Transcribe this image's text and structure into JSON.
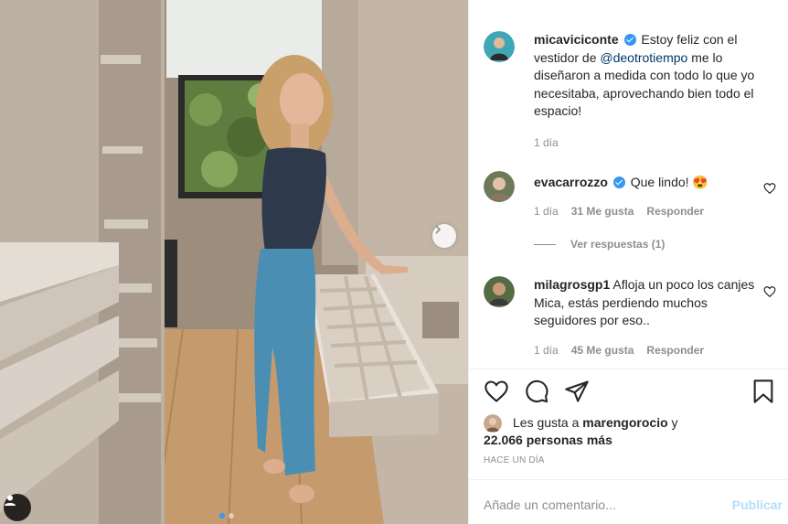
{
  "post": {
    "caption": {
      "username": "micaviciconte",
      "text_before": "Estoy feliz con el vestidor de ",
      "mention": "@deotrotiempo",
      "text_after": " me lo diseñaron a medida con todo lo que yo necesitaba, aprovechando bien todo el espacio!",
      "time": "1 día"
    },
    "comments": [
      {
        "username": "evacarrozzo",
        "verified": true,
        "text": "Que lindo! 😍",
        "time": "1 día",
        "likes": "31 Me gusta",
        "reply_label": "Responder",
        "view_replies": "Ver respuestas (1)"
      },
      {
        "username": "milagrosgp1",
        "verified": false,
        "text": "Afloja un poco los canjes Mica, estás perdiendo muchos seguidores por eso..",
        "time": "1 día",
        "likes": "45 Me gusta",
        "reply_label": "Responder"
      }
    ],
    "likes": {
      "prefix": "Les gusta a",
      "first_user": "marengorocio",
      "connector": "y",
      "others": "22.066 personas más"
    },
    "timestamp": "Hace un día",
    "add_comment_placeholder": "Añade un comentario...",
    "publish_label": "Publicar"
  },
  "icons": {
    "like": "heart-icon",
    "comment": "comment-icon",
    "share": "paper-plane-icon",
    "save": "bookmark-icon",
    "next": "chevron-right-icon",
    "tag": "user-tag-icon"
  },
  "colors": {
    "link": "#00376b",
    "verified": "#3897f0",
    "muted": "#8e8e8e",
    "publish_disabled": "#b2dffc"
  }
}
